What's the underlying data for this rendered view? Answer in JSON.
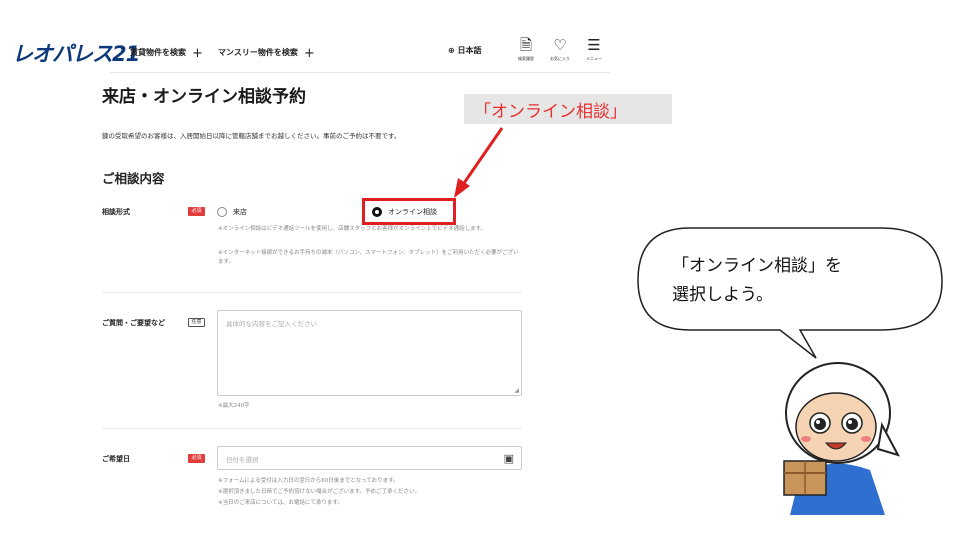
{
  "header": {
    "logo": "レオパレス21",
    "nav": [
      {
        "label": "賃貸物件を検索",
        "plus": "+"
      },
      {
        "label": "マンスリー物件を検索",
        "plus": "+"
      }
    ],
    "language": "⊕ 日本語",
    "icons": [
      {
        "icon": "history-icon",
        "label": "検索履歴"
      },
      {
        "icon": "heart-icon",
        "label": "お気に入り"
      },
      {
        "icon": "menu-icon",
        "label": "メニュー"
      }
    ]
  },
  "page": {
    "title": "来店・オンライン相談予約",
    "description": "鍵の受取希望のお客様は、入居開始日以降に管轄店舗までお越しください。事前のご予約は不要です。",
    "section_title": "ご相談内容"
  },
  "form": {
    "consult_type": {
      "label": "相談形式",
      "badge": "必須",
      "options": [
        {
          "label": "来店",
          "selected": false
        },
        {
          "label": "オンライン相談",
          "selected": true
        }
      ],
      "notes": [
        "※オンライン相談はビデオ通話ツールを使用し、店舗スタッフとお客様がオンライン上でビデオ通話します。",
        "※インターネット接続ができるお手持ちの端末（パソコン、スマートフォン、タブレット）をご利用いただく必要がございます。"
      ]
    },
    "questions": {
      "label": "ご質問・ご要望など",
      "badge": "任意",
      "placeholder": "具体的な内容をご記入ください",
      "limit_note": "※最大240字"
    },
    "date": {
      "label": "ご希望日",
      "badge": "必須",
      "placeholder": "日付を選択",
      "notes": [
        "※フォームによる受付は入力日の翌日から60日後までとなっております。",
        "※選択頂きました日時でご予約頂けない場合がございます。予めご了承ください。",
        "※当日のご来店については、お電話にて承ります。"
      ]
    }
  },
  "annotation": {
    "callout": "「オンライン相談」",
    "bubble_line1": "「オンライン相談」を",
    "bubble_line2": "選択しよう。",
    "accent_color": "#e02020"
  }
}
